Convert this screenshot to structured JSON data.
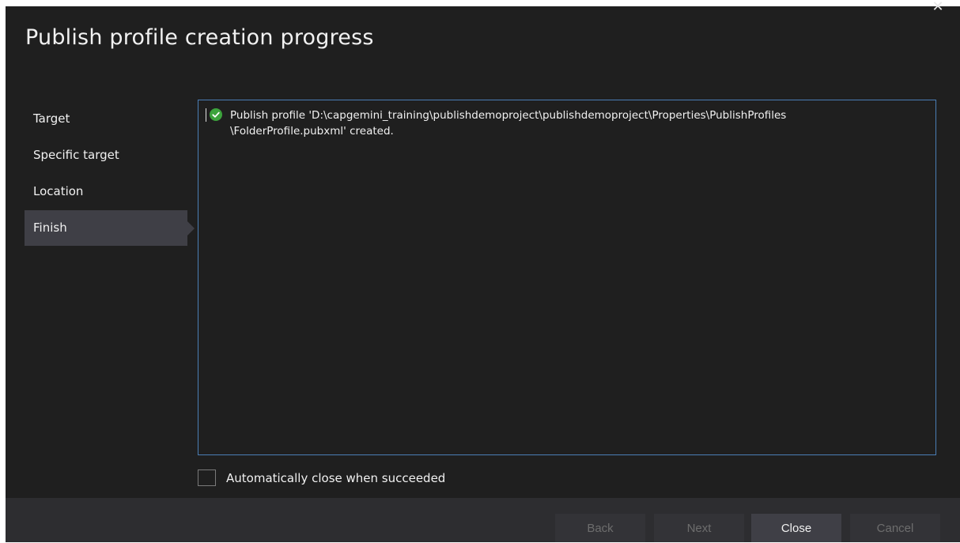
{
  "dialog": {
    "title": "Publish profile creation progress",
    "close_glyph": "✕"
  },
  "nav": {
    "items": [
      {
        "label": "Target",
        "active": false
      },
      {
        "label": "Specific target",
        "active": false
      },
      {
        "label": "Location",
        "active": false
      },
      {
        "label": "Finish",
        "active": true
      }
    ]
  },
  "log": {
    "entries": [
      {
        "status_icon": "success-check-icon",
        "text": "Publish profile 'D:\\capgemini_training\\publishdemoproject\\publishdemoproject\\Properties\\PublishProfiles\n\\FolderProfile.pubxml' created."
      }
    ]
  },
  "options": {
    "auto_close_label": "Automatically close when succeeded",
    "auto_close_checked": false
  },
  "buttons": {
    "back": "Back",
    "next": "Next",
    "close": "Close",
    "cancel": "Cancel"
  },
  "colors": {
    "background": "#1f1f1f",
    "footer": "#2d2d30",
    "accent_border": "#4a7eb5",
    "success": "#3ca33c"
  }
}
